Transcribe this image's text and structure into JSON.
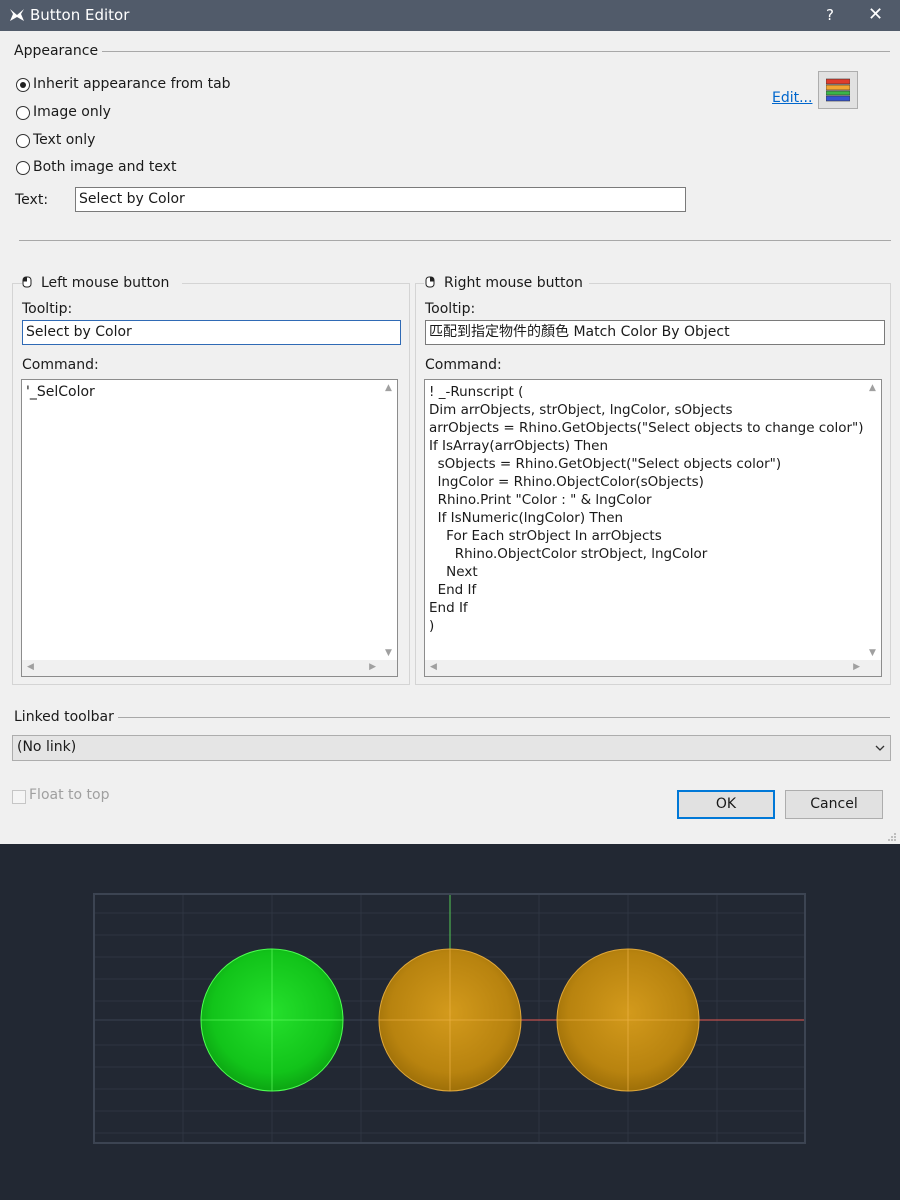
{
  "window": {
    "title": "Button Editor",
    "help_label": "?",
    "close_label": "✕"
  },
  "appearance": {
    "section_label": "Appearance",
    "options": [
      {
        "label": "Inherit appearance from tab",
        "selected": true
      },
      {
        "label": "Image only",
        "selected": false
      },
      {
        "label": "Text only",
        "selected": false
      },
      {
        "label": "Both image and text",
        "selected": false
      }
    ],
    "text_label": "Text:",
    "text_value": "Select by Color",
    "edit_link": "Edit...",
    "icon": "color-stripes-icon",
    "icon_colors": [
      "#e03c2c",
      "#f2a532",
      "#3ab54a",
      "#3453d1"
    ]
  },
  "left_mouse": {
    "header": "Left mouse button",
    "icon": "mouse-left-icon",
    "tooltip_label": "Tooltip:",
    "tooltip_value": "Select by Color",
    "command_label": "Command:",
    "command_text": "'_SelColor"
  },
  "right_mouse": {
    "header": "Right mouse button",
    "icon": "mouse-right-icon",
    "tooltip_label": "Tooltip:",
    "tooltip_value": "匹配到指定物件的顏色 Match Color By Object",
    "command_label": "Command:",
    "command_text": "! _-Runscript (\nDim arrObjects, strObject, lngColor, sObjects\narrObjects = Rhino.GetObjects(\"Select objects to change color\")\nIf IsArray(arrObjects) Then\n  sObjects = Rhino.GetObject(\"Select objects color\")\n  lngColor = Rhino.ObjectColor(sObjects)\n  Rhino.Print \"Color : \" & lngColor\n  If IsNumeric(lngColor) Then\n    For Each strObject In arrObjects\n      Rhino.ObjectColor strObject, lngColor\n    Next\n  End If\nEnd If\n)"
  },
  "linked_toolbar": {
    "section_label": "Linked toolbar",
    "selected": "(No link)"
  },
  "footer": {
    "float_to_top": "Float to top",
    "float_checked": false,
    "ok_label": "OK",
    "cancel_label": "Cancel"
  },
  "viewport": {
    "spheres": [
      {
        "name": "green-sphere",
        "color": "#14c81e"
      },
      {
        "name": "gold-sphere-1",
        "color": "#c08a12"
      },
      {
        "name": "gold-sphere-2",
        "color": "#c08a12"
      }
    ],
    "axis_colors": {
      "x": "#c0504d",
      "y": "#4caf50",
      "grid": "#2e3542"
    }
  }
}
